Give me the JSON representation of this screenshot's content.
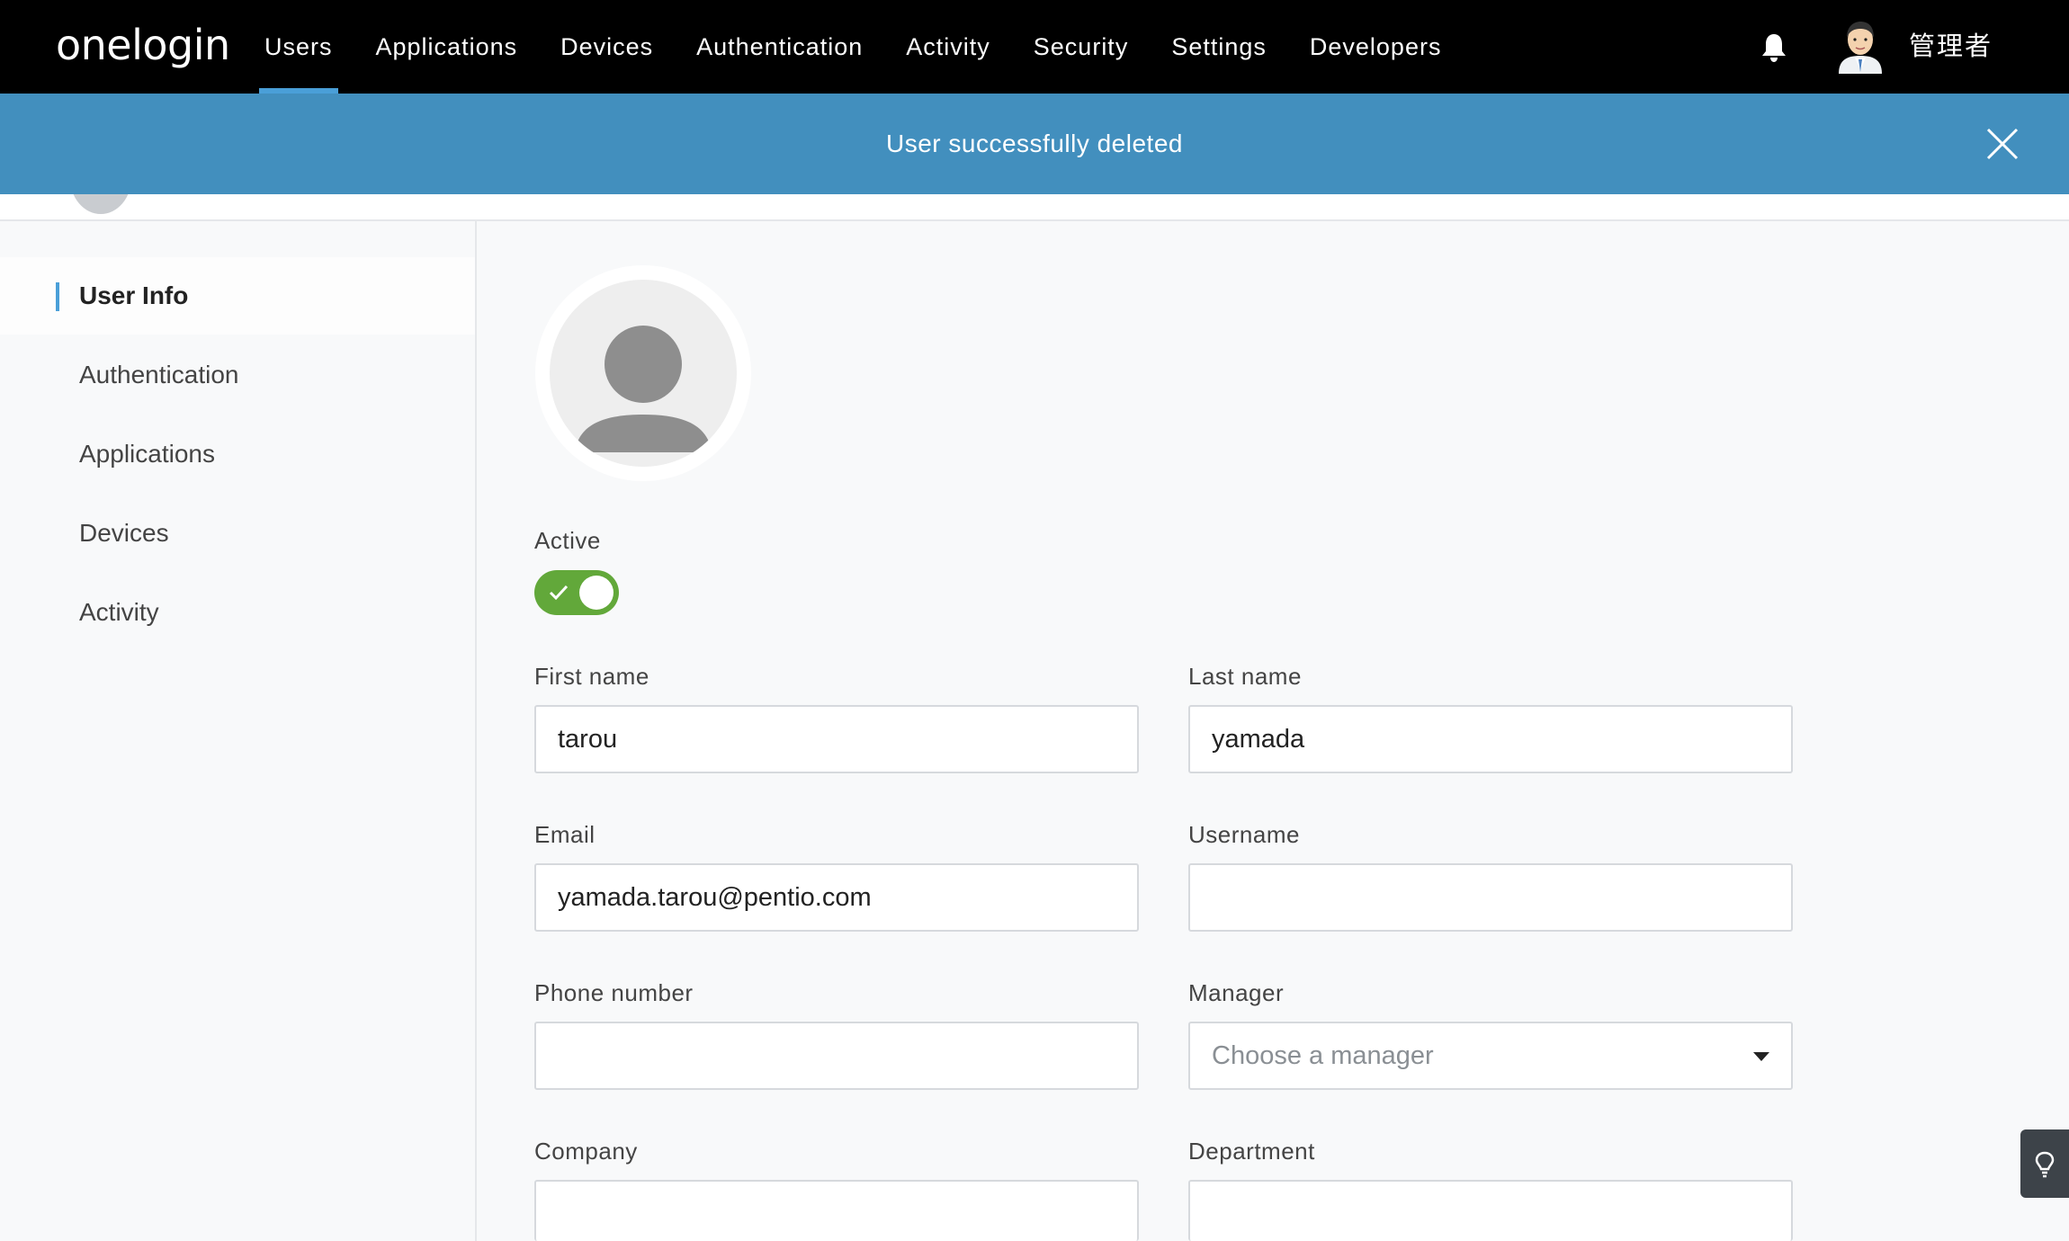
{
  "brand": {
    "logo_text": "onelogin",
    "accent_color": "#4a9fd8"
  },
  "topnav": {
    "items": [
      {
        "label": "Users",
        "active": true
      },
      {
        "label": "Applications"
      },
      {
        "label": "Devices"
      },
      {
        "label": "Authentication"
      },
      {
        "label": "Activity"
      },
      {
        "label": "Security"
      },
      {
        "label": "Settings"
      },
      {
        "label": "Developers"
      }
    ],
    "bell_icon": "bell-icon",
    "admin_name": "管理者"
  },
  "banner": {
    "message": "User successfully deleted",
    "color": "#428fbe",
    "close_icon": "close-icon"
  },
  "sidebar": {
    "items": [
      {
        "label": "User Info",
        "active": true
      },
      {
        "label": "Authentication"
      },
      {
        "label": "Applications"
      },
      {
        "label": "Devices"
      },
      {
        "label": "Activity"
      }
    ]
  },
  "form": {
    "active_label": "Active",
    "active_value": true,
    "toggle_color": "#62a83a",
    "first_name": {
      "label": "First name",
      "value": "tarou"
    },
    "last_name": {
      "label": "Last name",
      "value": "yamada"
    },
    "email": {
      "label": "Email",
      "value": "yamada.tarou@pentio.com"
    },
    "username": {
      "label": "Username",
      "value": ""
    },
    "phone": {
      "label": "Phone number",
      "value": ""
    },
    "manager": {
      "label": "Manager",
      "placeholder": "Choose a manager"
    },
    "company": {
      "label": "Company",
      "value": ""
    },
    "department": {
      "label": "Department",
      "value": ""
    }
  },
  "help_icon": "lightbulb-icon"
}
